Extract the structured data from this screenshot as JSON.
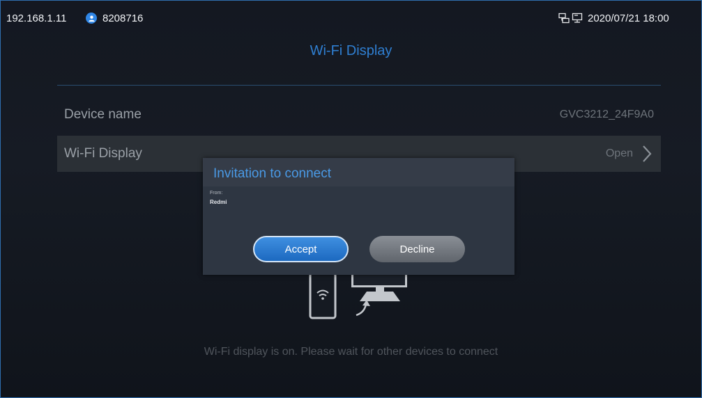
{
  "status_bar": {
    "ip": "192.168.1.11",
    "extension": "8208716",
    "datetime": "2020/07/21  18:00",
    "icons": [
      "user-icon",
      "network-icon",
      "pc-display-icon"
    ]
  },
  "page": {
    "title": "Wi-Fi Display",
    "rows": [
      {
        "label": "Device name",
        "value": "GVC3212_24F9A0"
      },
      {
        "label": "Wi-Fi Display",
        "value": "Open"
      }
    ],
    "hint": "Wi-Fi display is on. Please wait for other devices to connect"
  },
  "dialog": {
    "title": "Invitation to connect",
    "from_label": "From:",
    "sender": "Redmi",
    "accept_label": "Accept",
    "decline_label": "Decline"
  },
  "colors": {
    "accent": "#2f7fd2",
    "background": "#141821",
    "dialog_bg": "#2e3642",
    "accept_button": "#2a7ad2",
    "decline_button": "#747980"
  }
}
